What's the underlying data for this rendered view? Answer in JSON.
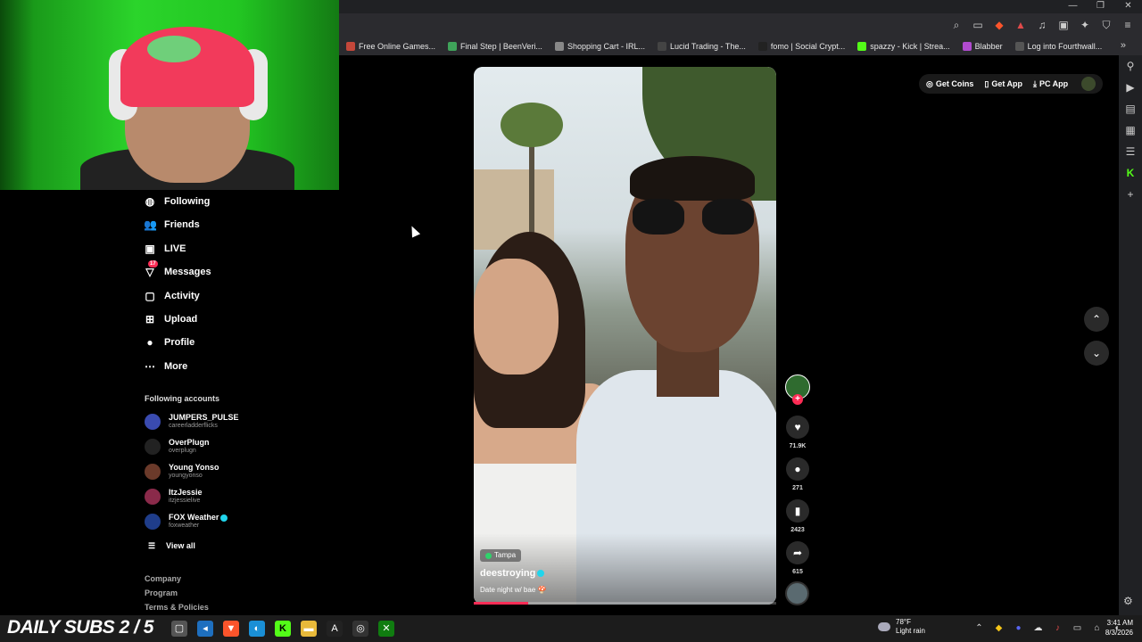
{
  "browser": {
    "bookmarks": [
      {
        "label": "Free Online Games...",
        "color": "#c4473a"
      },
      {
        "label": "Final Step | BeenVeri...",
        "color": "#3fa35a"
      },
      {
        "label": "Shopping Cart - IRL...",
        "color": "#888888"
      },
      {
        "label": "Lucid Trading - The...",
        "color": "#444444"
      },
      {
        "label": "fomo | Social Crypt...",
        "color": "#222222"
      },
      {
        "label": "spazzy - Kick | Strea...",
        "color": "#53fc18"
      },
      {
        "label": "Blabber",
        "color": "#b14bd0"
      },
      {
        "label": "Log into Fourthwall...",
        "color": "#555555"
      }
    ],
    "more_label": "»"
  },
  "topbar": {
    "get_coins": "Get Coins",
    "get_app": "Get App",
    "pc_app": "PC App"
  },
  "sidebar": {
    "nav": [
      {
        "label": "Following",
        "icon": "following-icon"
      },
      {
        "label": "Friends",
        "icon": "friends-icon"
      },
      {
        "label": "LIVE",
        "icon": "live-icon"
      },
      {
        "label": "Messages",
        "icon": "messages-icon",
        "badge": "17"
      },
      {
        "label": "Activity",
        "icon": "activity-icon"
      },
      {
        "label": "Upload",
        "icon": "upload-icon"
      },
      {
        "label": "Profile",
        "icon": "profile-icon"
      },
      {
        "label": "More",
        "icon": "more-icon"
      }
    ],
    "following_title": "Following accounts",
    "accounts": [
      {
        "name": "JUMPERS_PULSE",
        "handle": "careerladderflicks",
        "verified": false
      },
      {
        "name": "OverPlugn",
        "handle": "overplugn",
        "verified": false
      },
      {
        "name": "Young Yonso",
        "handle": "youngyonso",
        "verified": false
      },
      {
        "name": "ItzJessie",
        "handle": "itzjessielive",
        "verified": false
      },
      {
        "name": "FOX Weather",
        "handle": "foxweather",
        "verified": true
      }
    ],
    "view_all": "View all",
    "footer": [
      "Company",
      "Program",
      "Terms & Policies"
    ]
  },
  "video": {
    "location": "Tampa",
    "author": "deestroying",
    "caption": "Date night w/ bae 🍄",
    "progress": 0.18
  },
  "actions": {
    "likes": "71.9K",
    "comments": "271",
    "saves": "2423",
    "shares": "615"
  },
  "taskbar": {
    "overlay_text": "DAILY SUBS 2 / 5",
    "weather_temp": "78°F",
    "weather_desc": "Light rain",
    "time": "3:41 AM",
    "date": "8/3/2026"
  }
}
